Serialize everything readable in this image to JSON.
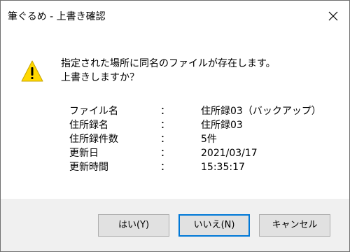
{
  "window": {
    "title": "筆ぐるめ - 上書き確認",
    "close_icon": "close-icon"
  },
  "message": {
    "icon": "warning-icon",
    "line1": "指定された場所に同名のファイルが存在します。",
    "line2": "上書きしますか？"
  },
  "info": [
    {
      "label": "ファイル名",
      "sep": "：",
      "value": "住所録03（バックアップ）"
    },
    {
      "label": "住所録名",
      "sep": "：",
      "value": "住所録03"
    },
    {
      "label": "住所録件数",
      "sep": "：",
      "value": "5件"
    },
    {
      "label": "更新日",
      "sep": "：",
      "value": "2021/03/17"
    },
    {
      "label": "更新時間",
      "sep": "：",
      "value": "15:35:17"
    }
  ],
  "buttons": {
    "yes": "はい(Y)",
    "no": "いいえ(N)",
    "cancel": "キャンセル"
  },
  "colors": {
    "warning_fill": "#ffd800",
    "default_button_border": "#0078d7"
  }
}
